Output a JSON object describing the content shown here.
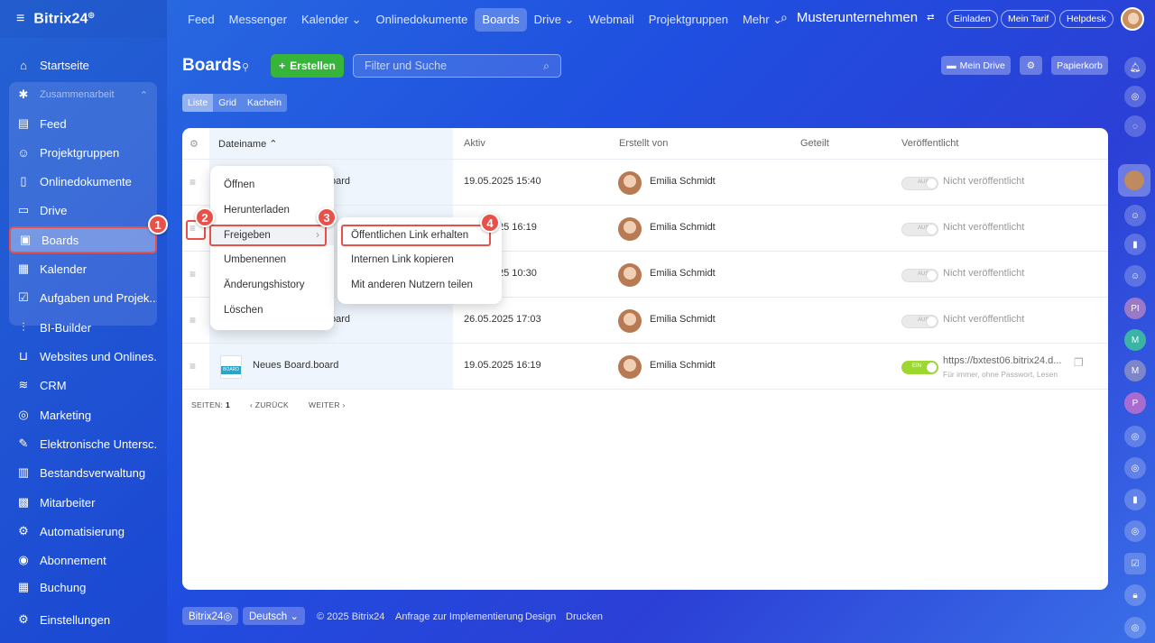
{
  "topbar": {
    "brand": "Bitrix24",
    "brand_mark": "◎",
    "nav": [
      "Feed",
      "Messenger",
      "Kalender ⌄",
      "Onlinedokumente",
      "Boards",
      "Drive ⌄",
      "Webmail",
      "Projektgruppen",
      "Mehr ⌄"
    ],
    "company": "Musterunternehmen",
    "buttons": [
      "Einladen",
      "Mein Tarif",
      "Helpdesk"
    ]
  },
  "sidebar": {
    "items": [
      {
        "label": "Startseite",
        "icon": "⌂"
      },
      {
        "label": "Zusammenarbeit",
        "icon": "✱"
      },
      {
        "label": "Feed",
        "icon": "▤"
      },
      {
        "label": "Projektgruppen",
        "icon": "☺"
      },
      {
        "label": "Onlinedokumente",
        "icon": "▯"
      },
      {
        "label": "Drive",
        "icon": "▭"
      },
      {
        "label": "Boards",
        "icon": "▣"
      },
      {
        "label": "Kalender",
        "icon": "▦"
      },
      {
        "label": "Aufgaben und Projek...",
        "icon": "☑"
      },
      {
        "label": "BI-Builder",
        "icon": "⫶"
      },
      {
        "label": "Websites und Onlines...",
        "icon": "⊔"
      },
      {
        "label": "CRM",
        "icon": "≋"
      },
      {
        "label": "Marketing",
        "icon": "◎"
      },
      {
        "label": "Elektronische Untersc...",
        "icon": "✎"
      },
      {
        "label": "Bestandsverwaltung",
        "icon": "▥"
      },
      {
        "label": "Mitarbeiter",
        "icon": "▩"
      },
      {
        "label": "Automatisierung",
        "icon": "⚙"
      },
      {
        "label": "Abonnement",
        "icon": "◉"
      },
      {
        "label": "Buchung",
        "icon": "▦"
      },
      {
        "label": "Einstellungen",
        "icon": "⚙"
      }
    ]
  },
  "page": {
    "title": "Boards",
    "create": "Erstellen",
    "search_placeholder": "Filter und Suche",
    "mein_drive": "Mein Drive",
    "papierkorb": "Papierkorb",
    "views": [
      "Liste",
      "Grid",
      "Kacheln"
    ]
  },
  "table": {
    "headers": [
      "Dateiname ⌃",
      "Aktiv",
      "Erstellt von",
      "Geteilt",
      "Veröffentlicht"
    ],
    "rows": [
      {
        "name": "oard",
        "date": "19.05.2025 15:40",
        "user": "Emilia Schmidt",
        "pub": "Nicht veröffentlicht",
        "toggle": "AUS"
      },
      {
        "name": "",
        "date": "25 16:19",
        "user": "Emilia Schmidt",
        "pub": "Nicht veröffentlicht",
        "toggle": "AUS"
      },
      {
        "name": "",
        "date": "25 10:30",
        "user": "Emilia Schmidt",
        "pub": "Nicht veröffentlicht",
        "toggle": "AUS"
      },
      {
        "name": "oard",
        "date": "26.05.2025 17:03",
        "user": "Emilia Schmidt",
        "pub": "Nicht veröffentlicht",
        "toggle": "AUS"
      },
      {
        "name": "Neues Board.board",
        "date": "19.05.2025 16:19",
        "user": "Emilia Schmidt",
        "pub": "https://bxtest06.bitrix24.d...",
        "pub_sub": "Für immer, ohne Passwort, Lesen",
        "toggle": "EIN"
      }
    ],
    "file_badge": "BOARD",
    "pager": {
      "label": "SEITEN:",
      "page": "1",
      "back": "‹ ZURÜCK",
      "next": "WEITER ›"
    }
  },
  "context_menu": {
    "items": [
      "Öffnen",
      "Herunterladen",
      "Freigeben",
      "Umbenennen",
      "Änderungshistory",
      "Löschen"
    ],
    "submenu": [
      "Öffentlichen Link erhalten",
      "Internen Link kopieren",
      "Mit anderen Nutzern teilen"
    ]
  },
  "markers": [
    "1",
    "2",
    "3",
    "4"
  ],
  "footer": {
    "brand": "Bitrix24◎",
    "lang": "Deutsch ⌄",
    "links": [
      "© 2025 Bitrix24",
      "Anfrage zur Implementierung",
      "Design",
      "Drucken"
    ]
  },
  "rightbar": {
    "initials": [
      "PI",
      "M",
      "M",
      "P"
    ]
  },
  "colors": {
    "accent": "#36b53a",
    "highlight": "#e8514a",
    "toggle_on": "#9cd830"
  }
}
